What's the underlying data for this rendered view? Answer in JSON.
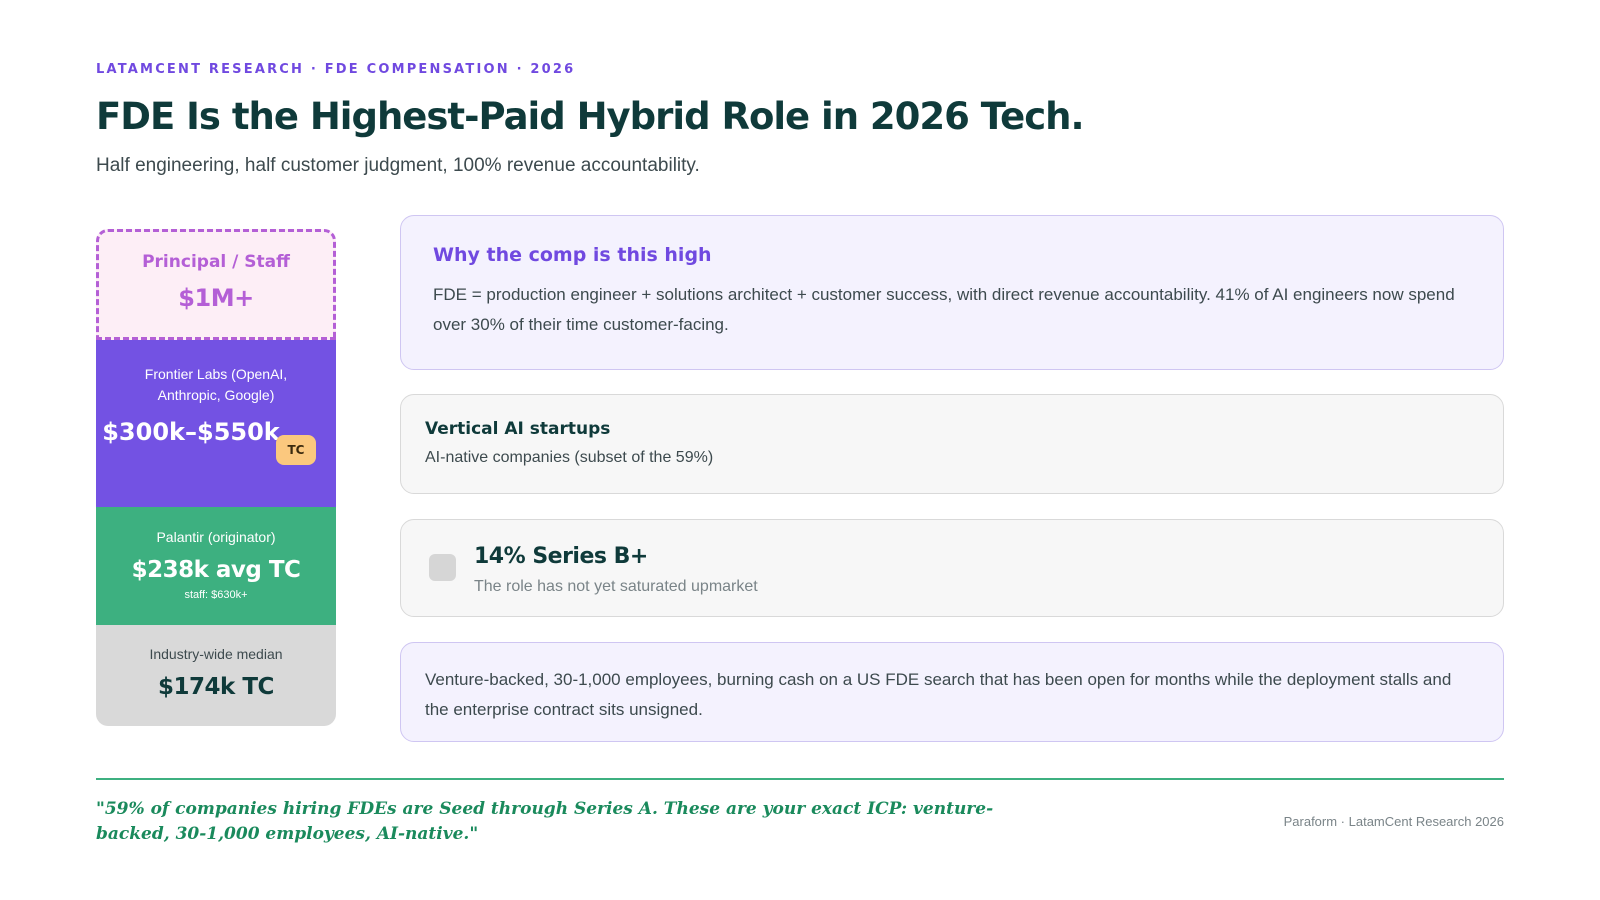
{
  "header": {
    "eyebrow": "LATAMCENT RESEARCH · FDE COMPENSATION · 2026",
    "title": "FDE Is the Highest-Paid Hybrid Role in 2026 Tech.",
    "subtitle": "Half engineering, half customer judgment, 100% revenue accountability."
  },
  "ladder": {
    "principal": {
      "label": "Principal / Staff",
      "value": "$1M+"
    },
    "frontier": {
      "label": "Frontier Labs (OpenAI, Anthropic, Google)",
      "value": "$300k–$550k",
      "badge": "TC"
    },
    "palantir": {
      "label": "Palantir (originator)",
      "value": "$238k avg TC",
      "note": "staff: $630k+"
    },
    "median": {
      "label": "Industry-wide median",
      "value": "$174k TC"
    }
  },
  "cards": {
    "why": {
      "title": "Why the comp is this high",
      "body": "FDE = production engineer + solutions architect + customer success, with direct revenue accountability. 41% of AI engineers now spend over 30% of their time customer-facing."
    },
    "vertical": {
      "title": "Vertical AI startups",
      "body": "AI-native companies (subset of the 59%)"
    },
    "series": {
      "title": "14% Series B+",
      "body": "The role has not yet saturated upmarket"
    },
    "venture": {
      "body": "Venture-backed, 30-1,000 employees, burning cash on a US FDE search that has been open for months while the deployment stalls and the enterprise contract sits unsigned."
    }
  },
  "footer": {
    "quote": "\"59% of companies hiring FDEs are Seed through Series A. These are your exact ICP: venture-backed, 30-1,000 employees, AI-native.\"",
    "source": "Paraform · LatamCent Research 2026"
  }
}
